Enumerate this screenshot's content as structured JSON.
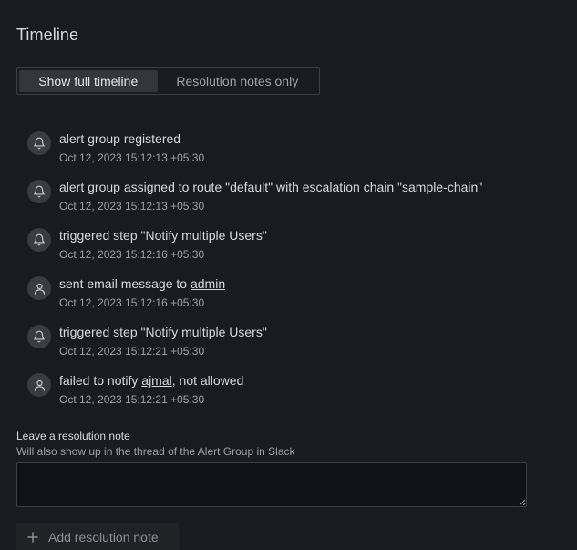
{
  "title": "Timeline",
  "toggle": {
    "options": [
      "Show full timeline",
      "Resolution notes only"
    ],
    "selected": "Show full timeline"
  },
  "events": [
    {
      "icon": "bell-icon",
      "text_before": "alert group registered",
      "link": "",
      "text_after": "",
      "time": "Oct 12, 2023 15:12:13 +05:30"
    },
    {
      "icon": "bell-icon",
      "text_before": "alert group assigned to route \"default\" with escalation chain \"sample-chain\"",
      "link": "",
      "text_after": "",
      "time": "Oct 12, 2023 15:12:13 +05:30"
    },
    {
      "icon": "bell-icon",
      "text_before": "triggered step \"Notify multiple Users\"",
      "link": "",
      "text_after": "",
      "time": "Oct 12, 2023 15:12:16 +05:30"
    },
    {
      "icon": "user-icon",
      "text_before": "sent email message to ",
      "link": "admin",
      "text_after": "",
      "time": "Oct 12, 2023 15:12:16 +05:30"
    },
    {
      "icon": "bell-icon",
      "text_before": "triggered step \"Notify multiple Users\"",
      "link": "",
      "text_after": "",
      "time": "Oct 12, 2023 15:12:21 +05:30"
    },
    {
      "icon": "user-icon",
      "text_before": "failed to notify ",
      "link": "ajmal",
      "text_after": ", not allowed",
      "time": "Oct 12, 2023 15:12:21 +05:30"
    }
  ],
  "resolution_note": {
    "label": "Leave a resolution note",
    "description": "Will also show up in the thread of the Alert Group in Slack",
    "value": "",
    "button_label": "Add resolution note",
    "button_icon": "plus-icon"
  }
}
